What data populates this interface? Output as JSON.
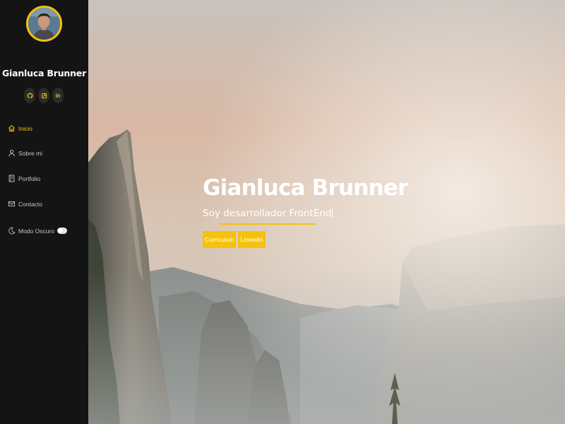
{
  "profile": {
    "name": "Gianluca Brunner",
    "avatar_icon": "person-photo"
  },
  "socials": [
    {
      "name": "github",
      "icon": "github-icon"
    },
    {
      "name": "codepen",
      "icon": "platzi-icon"
    },
    {
      "name": "linkedin",
      "icon": "linkedin-icon",
      "text": "in"
    }
  ],
  "nav": {
    "items": [
      {
        "label": "Inicio",
        "icon": "home-icon",
        "active": true
      },
      {
        "label": "Sobre mi",
        "icon": "user-icon",
        "active": false
      },
      {
        "label": "Portfolio",
        "icon": "book-icon",
        "active": false
      },
      {
        "label": "Contacto",
        "icon": "mail-icon",
        "active": false
      }
    ],
    "dark_mode_label": "Modo Oscuro",
    "dark_mode_icon": "moon-icon"
  },
  "hero": {
    "title": "Gianluca Brunner",
    "subtitle": "Soy desarrollador FrontEnd",
    "buttons": {
      "cv_label": "Curriculum",
      "linkedin_label": "Linkedin"
    }
  },
  "colors": {
    "accent": "#f4c20d",
    "sidebar_bg": "#141414"
  }
}
